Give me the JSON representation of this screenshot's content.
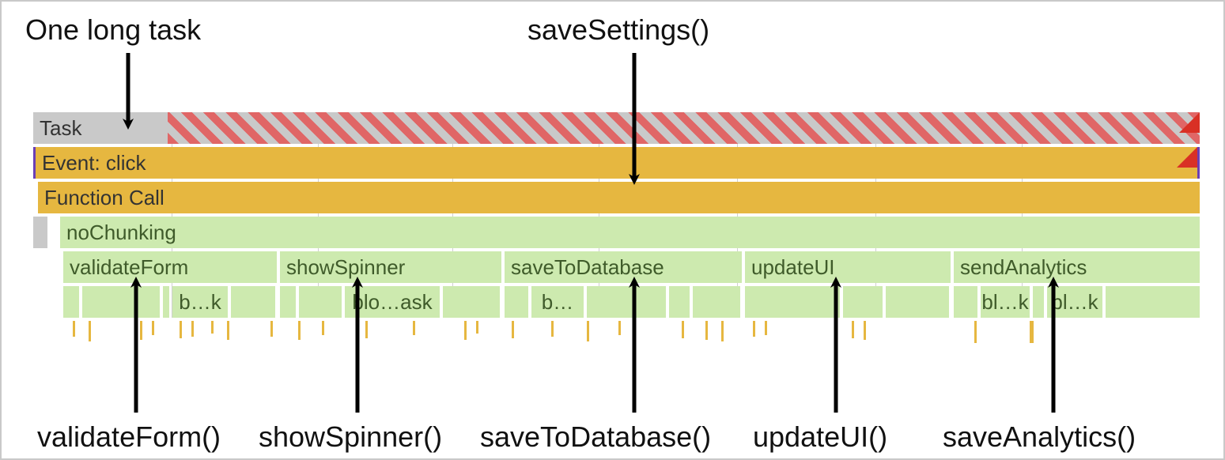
{
  "annotations": {
    "top_left": "One long task",
    "top_right": "saveSettings()",
    "bottom": [
      "validateForm()",
      "showSpinner()",
      "saveToDatabase()",
      "updateUI()",
      "saveAnalytics()"
    ]
  },
  "rows": {
    "task_label": "Task",
    "event_label": "Event: click",
    "funccall_label": "Function Call",
    "noChunking_label": "noChunking",
    "functions": [
      "validateForm",
      "showSpinner",
      "saveToDatabase",
      "updateUI",
      "sendAnalytics"
    ],
    "blocks": [
      "b…k",
      "blo…ask",
      "b…",
      "bl…k",
      "bl…k"
    ]
  }
}
